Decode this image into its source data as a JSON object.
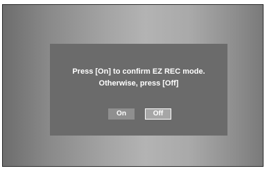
{
  "dialog": {
    "line1": "Press [On] to confirm EZ REC mode.",
    "line2": "Otherwise, press [Off]",
    "buttons": {
      "on_label": "On",
      "off_label": "Off",
      "selected": "Off"
    }
  },
  "colors": {
    "dialog_bg": "#6b6b6b",
    "text": "#ffffff",
    "on_button_bg": "#8f8f8f",
    "off_button_bg": "#a6a6a6",
    "selected_border": "#ffffff"
  }
}
